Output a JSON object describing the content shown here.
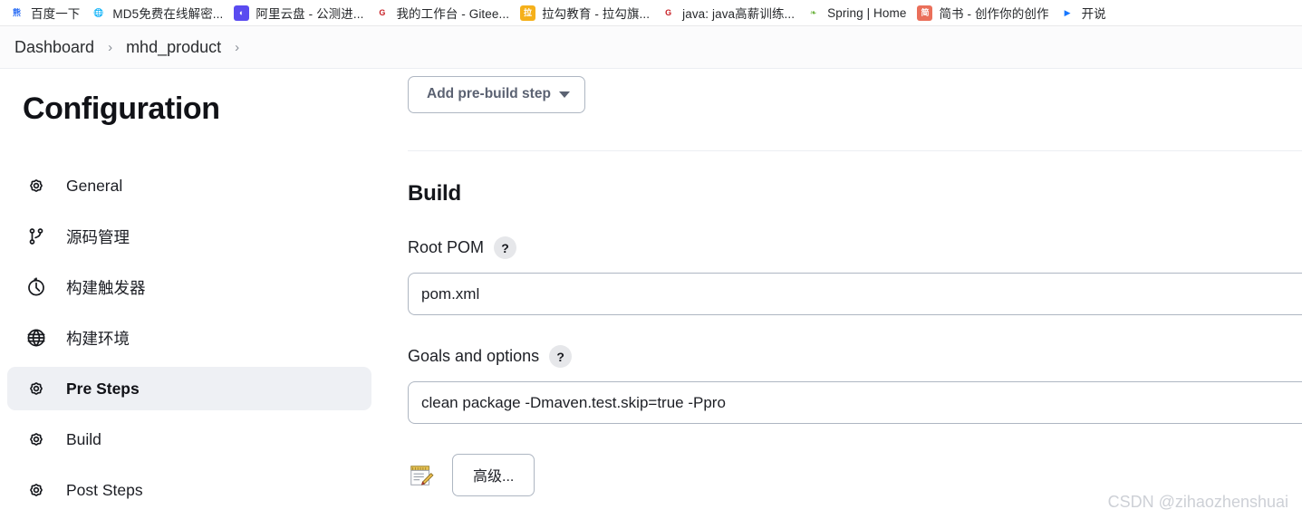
{
  "browser": {
    "bookmarks": [
      {
        "label": "百度一下",
        "icon": "baidu-icon",
        "bg": "#ffffff",
        "fg": "#2a6df5",
        "glyph": "熊"
      },
      {
        "label": "MD5免费在线解密...",
        "icon": "globe-icon",
        "bg": "#ffffff",
        "fg": "#5f6368",
        "glyph": "🌐"
      },
      {
        "label": "阿里云盘 - 公测进...",
        "icon": "aliyun-icon",
        "bg": "#5a4bf0",
        "fg": "#ffffff",
        "glyph": "◐"
      },
      {
        "label": "我的工作台 - Gitee...",
        "icon": "gitee-icon",
        "bg": "#ffffff",
        "fg": "#c71d23",
        "glyph": "G"
      },
      {
        "label": "拉勾教育 - 拉勾旗...",
        "icon": "lagou-icon",
        "bg": "#f5b01a",
        "fg": "#ffffff",
        "glyph": "拉"
      },
      {
        "label": "java: java高薪训练...",
        "icon": "gitee-icon-2",
        "bg": "#ffffff",
        "fg": "#c71d23",
        "glyph": "G"
      },
      {
        "label": "Spring | Home",
        "icon": "spring-icon",
        "bg": "#ffffff",
        "fg": "#6db33f",
        "glyph": "❧"
      },
      {
        "label": "简书 - 创作你的创作",
        "icon": "jianshu-icon",
        "bg": "#ea6f5a",
        "fg": "#ffffff",
        "glyph": "简"
      },
      {
        "label": "开说",
        "icon": "kaiyuan-icon",
        "bg": "#ffffff",
        "fg": "#1677ff",
        "glyph": "▶"
      }
    ]
  },
  "breadcrumb": {
    "items": [
      "Dashboard",
      "mhd_product"
    ],
    "separator": "›"
  },
  "sidebar": {
    "title": "Configuration",
    "items": [
      {
        "label": "General",
        "icon": "gear-icon",
        "active": false
      },
      {
        "label": "源码管理",
        "icon": "git-branch-icon",
        "active": false
      },
      {
        "label": "构建触发器",
        "icon": "clock-icon",
        "active": false
      },
      {
        "label": "构建环境",
        "icon": "globe-icon",
        "active": false
      },
      {
        "label": "Pre Steps",
        "icon": "gear-icon",
        "active": true
      },
      {
        "label": "Build",
        "icon": "gear-icon",
        "active": false
      },
      {
        "label": "Post Steps",
        "icon": "gear-icon",
        "active": false
      }
    ]
  },
  "main": {
    "add_prebuild_step_label": "Add pre-build step",
    "build_heading": "Build",
    "root_pom": {
      "label": "Root POM",
      "help": "?",
      "value": "pom.xml"
    },
    "goals_and_options": {
      "label": "Goals and options",
      "help": "?",
      "value": "clean package -Dmaven.test.skip=true -Ppro"
    },
    "advanced_button_label": "高级...",
    "notepad_icon": "notepad-pencil-icon"
  },
  "watermark": "CSDN @zihaozhenshuai",
  "colors": {
    "active_nav_bg": "#eef0f4",
    "button_border": "#aeb6c2",
    "button_text": "#5b6272",
    "help_badge_bg": "#e6e7ea",
    "watermark": "#cdd0d6"
  }
}
